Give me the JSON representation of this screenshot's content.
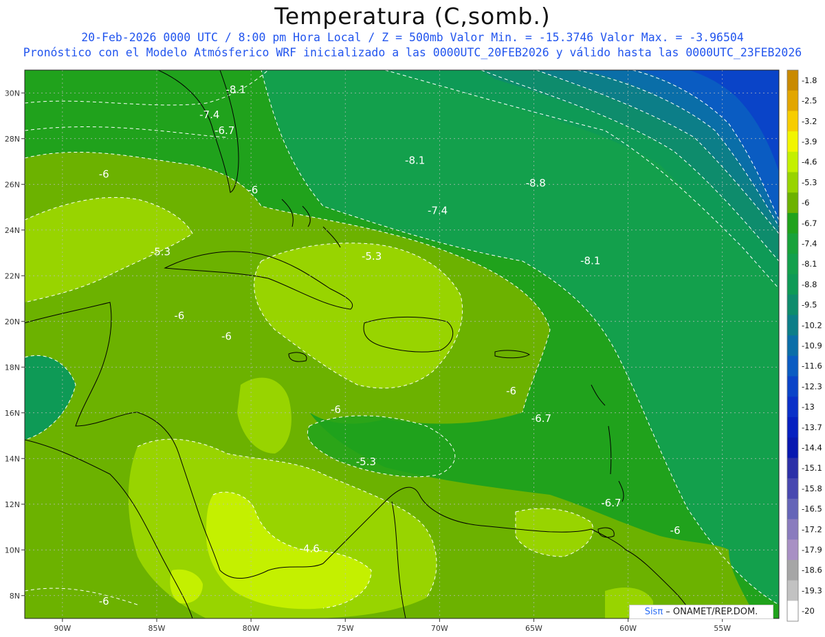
{
  "header": {
    "title": "Temperatura (C,somb.)",
    "subtitle_line1": "20-Feb-2026  0000 UTC / 8:00 pm Hora Local / Z = 500mb  Valor Min. = -15.3746  Valor Max. = -3.96504",
    "subtitle_line2": "Pronóstico con el Modelo Atmósferico WRF inicializado a las 0000UTC_20FEB2026 y válido hasta las  0000UTC_23FEB2026"
  },
  "map": {
    "lon_range": [
      -92,
      -52
    ],
    "lat_range": [
      7,
      31
    ],
    "lon_ticks": [
      "90W",
      "85W",
      "80W",
      "75W",
      "70W",
      "65W",
      "60W",
      "55W"
    ],
    "lat_ticks": [
      "8N",
      "10N",
      "12N",
      "14N",
      "16N",
      "18N",
      "20N",
      "22N",
      "24N",
      "26N",
      "28N",
      "30N"
    ],
    "contour_labels": [
      {
        "text": "-8.1",
        "lon": -80.8,
        "lat": 30.0
      },
      {
        "text": "-7.4",
        "lon": -82.2,
        "lat": 28.9
      },
      {
        "text": "-6.7",
        "lon": -81.4,
        "lat": 28.2
      },
      {
        "text": "-6",
        "lon": -87.8,
        "lat": 26.3
      },
      {
        "text": "-6",
        "lon": -79.9,
        "lat": 25.6
      },
      {
        "text": "-8.1",
        "lon": -71.3,
        "lat": 26.9
      },
      {
        "text": "-8.8",
        "lon": -64.9,
        "lat": 25.9
      },
      {
        "text": "-7.4",
        "lon": -70.1,
        "lat": 24.7
      },
      {
        "text": "-5.3",
        "lon": -84.8,
        "lat": 22.9
      },
      {
        "text": "-5.3",
        "lon": -73.6,
        "lat": 22.7
      },
      {
        "text": "-8.1",
        "lon": -62.0,
        "lat": 22.5
      },
      {
        "text": "-6",
        "lon": -83.8,
        "lat": 20.1
      },
      {
        "text": "-6",
        "lon": -81.3,
        "lat": 19.2
      },
      {
        "text": "-6",
        "lon": -66.2,
        "lat": 16.8
      },
      {
        "text": "-6",
        "lon": -75.5,
        "lat": 16.0
      },
      {
        "text": "-6.7",
        "lon": -64.6,
        "lat": 15.6
      },
      {
        "text": "-5.3",
        "lon": -73.9,
        "lat": 13.7
      },
      {
        "text": "-6.7",
        "lon": -60.9,
        "lat": 11.9
      },
      {
        "text": "-6",
        "lon": -57.5,
        "lat": 10.7
      },
      {
        "text": "-4.6",
        "lon": -76.9,
        "lat": 9.9
      },
      {
        "text": "-6",
        "lon": -87.8,
        "lat": 7.6
      }
    ]
  },
  "colorbar": {
    "labels": [
      "-1.8",
      "-2.5",
      "-3.2",
      "-3.9",
      "-4.6",
      "-5.3",
      "-6",
      "-6.7",
      "-7.4",
      "-8.1",
      "-8.8",
      "-9.5",
      "-10.2",
      "-10.9",
      "-11.6",
      "-12.3",
      "-13",
      "-13.7",
      "-14.4",
      "-15.1",
      "-15.8",
      "-16.5",
      "-17.2",
      "-17.9",
      "-18.6",
      "-19.3",
      "-20"
    ],
    "colors": [
      "#c98a00",
      "#e2a600",
      "#f7cd00",
      "#f2f500",
      "#c4f000",
      "#98d400",
      "#6cb200",
      "#20a21c",
      "#18a23a",
      "#13a04c",
      "#0e9a56",
      "#0e8c6c",
      "#0c7e88",
      "#0a6ea8",
      "#0a5cc2",
      "#0a44c8",
      "#0a30c8",
      "#0620c0",
      "#0818b0",
      "#2c30a8",
      "#4848b0",
      "#6565b8",
      "#8a7cbe",
      "#a890c4",
      "#a6a6a6",
      "#c2c2c2",
      "#ffffff"
    ]
  },
  "credit": {
    "sis": "Sisπ",
    "rest": " – ONAMET/REP.DOM."
  }
}
